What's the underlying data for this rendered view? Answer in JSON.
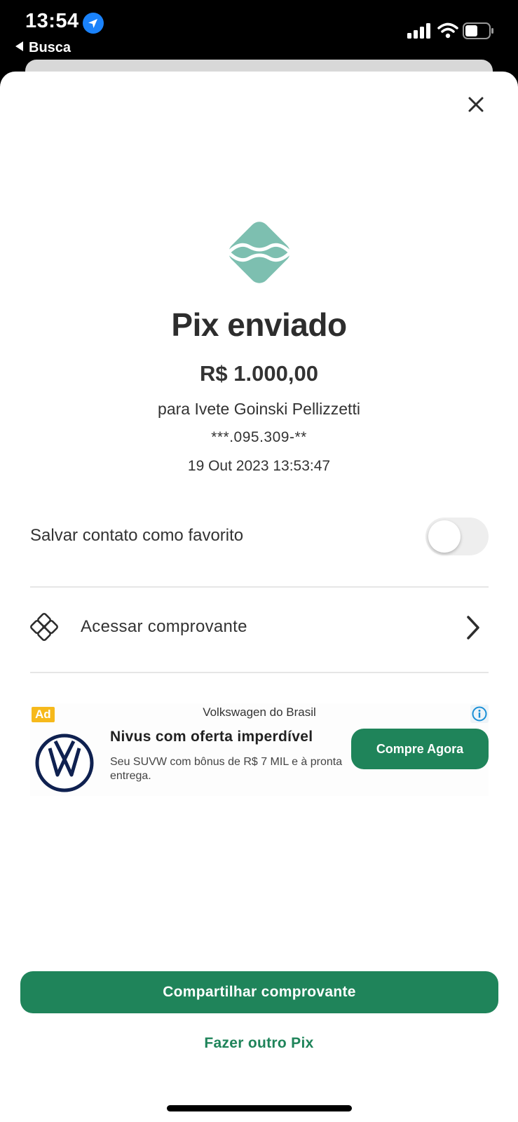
{
  "status_bar": {
    "time": "13:54",
    "back_label": "Busca",
    "icons": [
      "location-arrow-icon",
      "signal-bars-icon",
      "wifi-icon",
      "battery-icon"
    ]
  },
  "sheet": {
    "close_icon": "close-icon",
    "logo_icon": "pix-logo-icon",
    "title": "Pix enviado",
    "amount": "R$ 1.000,00",
    "recipient": "para Ivete Goinski Pellizzetti",
    "document": "***.095.309-**",
    "datetime": "19 Out 2023 13:53:47"
  },
  "favorite": {
    "label": "Salvar contato como favorito",
    "toggle_on": false
  },
  "receipt_link": {
    "label": "Acessar comprovante",
    "icon": "pix-outline-icon",
    "chevron_icon": "chevron-right-icon"
  },
  "ad": {
    "badge": "Ad",
    "advertiser": "Volkswagen do Brasil",
    "headline": "Nivus com oferta imperdível",
    "body": "Seu SUVW com bônus de R$ 7 MIL e à pronta entrega.",
    "cta": "Compre Agora",
    "logo_icon": "volkswagen-logo-icon",
    "info_icon": "info-icon"
  },
  "actions": {
    "primary": "Compartilhar comprovante",
    "secondary": "Fazer outro Pix"
  },
  "colors": {
    "accent": "#1f845a",
    "pix_logo": "#7dbfb0",
    "title_text": "#2d2d2d",
    "ad_badge": "#f6b91b",
    "vw_blue": "#0f2150"
  }
}
